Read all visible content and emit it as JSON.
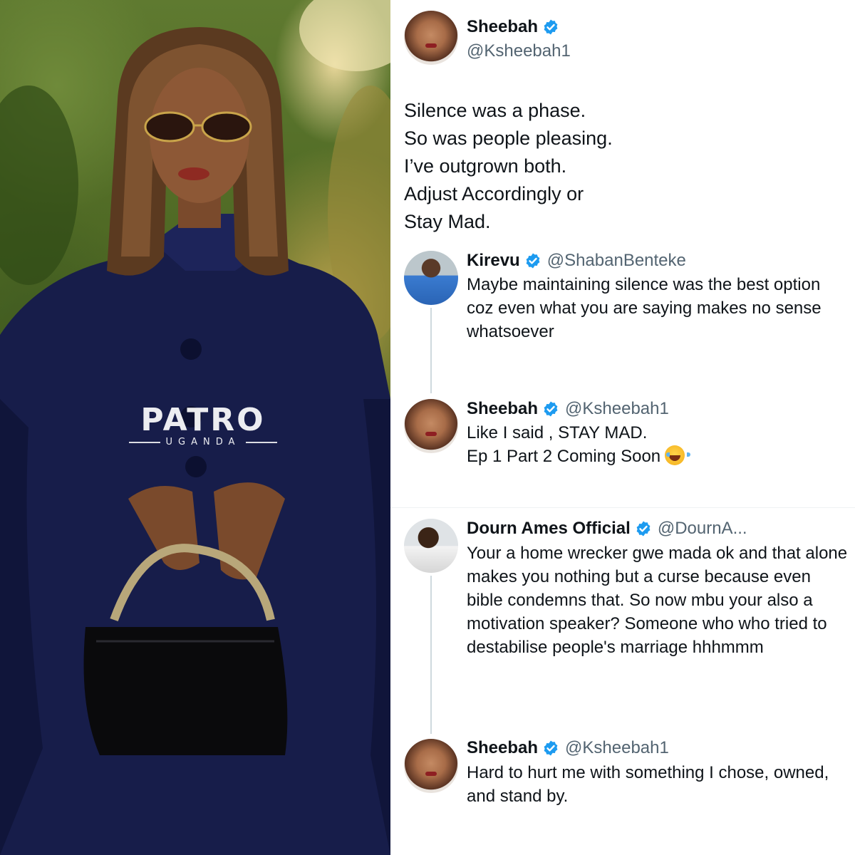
{
  "colors": {
    "verified_badge": "#1d9bf0",
    "handle_gray": "#536471",
    "text_dark": "#0f1419",
    "thread_line": "#cfd9de"
  },
  "watermark": {
    "brand": "PATRO",
    "sub": "UGANDA"
  },
  "main_tweet": {
    "author": {
      "name": "Sheebah",
      "handle": "@Ksheebah1",
      "verified": true,
      "avatar": "sheebah-avatar"
    },
    "lines": [
      "Silence was a phase.",
      "So was people pleasing.",
      "I’ve outgrown both.",
      "Adjust Accordingly or",
      "Stay Mad."
    ]
  },
  "replies": [
    {
      "author": {
        "name": "Kirevu",
        "handle": "@ShabanBenteke",
        "verified": true,
        "avatar": "kirevu-avatar"
      },
      "text": "Maybe maintaining silence was the best option coz even what you are saying makes no sense whatsoever"
    },
    {
      "author": {
        "name": "Sheebah",
        "handle": "@Ksheebah1",
        "verified": true,
        "avatar": "sheebah-avatar"
      },
      "lines": [
        "Like I said , STAY MAD.",
        "Ep 1 Part 2 Coming Soon"
      ],
      "emoji": "face-with-tears-of-joy"
    },
    {
      "author": {
        "name": "Dourn Ames Official",
        "handle": "@DournA...",
        "verified": true,
        "avatar": "dourn-avatar"
      },
      "text": "Your a home wrecker gwe mada ok and that alone makes you nothing but a curse because even bible condemns that. So now mbu  your also a motivation speaker? Someone who who tried to destabilise people's marriage hhhmmm"
    },
    {
      "author": {
        "name": "Sheebah",
        "handle": "@Ksheebah1",
        "verified": true,
        "avatar": "sheebah-avatar"
      },
      "text": "Hard to hurt me with something I chose, owned, and stand by."
    }
  ]
}
